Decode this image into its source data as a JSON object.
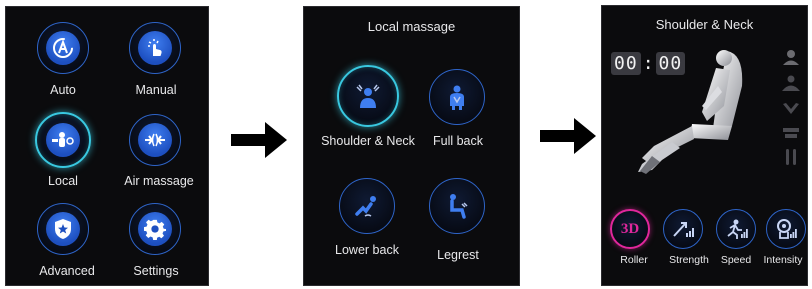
{
  "panel1": {
    "items": [
      {
        "label": "Auto",
        "icon": "auto-a-icon"
      },
      {
        "label": "Manual",
        "icon": "hand-touch-icon"
      },
      {
        "label": "Local",
        "icon": "local-massage-icon",
        "active": true
      },
      {
        "label": "Air massage",
        "icon": "air-arrows-icon"
      },
      {
        "label": "Advanced",
        "icon": "star-shield-icon"
      },
      {
        "label": "Settings",
        "icon": "gear-icon"
      }
    ]
  },
  "panel2": {
    "title": "Local massage",
    "items": [
      {
        "label": "Shoulder & Neck",
        "icon": "shoulder-neck-icon",
        "active": true
      },
      {
        "label": "Full back",
        "icon": "full-back-icon"
      },
      {
        "label": "Lower back",
        "icon": "lower-back-icon"
      },
      {
        "label": "Legrest",
        "icon": "legrest-icon"
      }
    ]
  },
  "panel3": {
    "title": "Shoulder & Neck",
    "timer": {
      "minutes": "00",
      "seconds": "00",
      "separator": ":"
    },
    "side_icons": [
      "neck-zone-icon",
      "shoulder-zone-icon",
      "back-zone-icon",
      "seat-zone-icon",
      "leg-zone-icon"
    ],
    "functions": [
      {
        "label": "Roller",
        "icon_text": "3D",
        "active": true
      },
      {
        "label": "Strength",
        "icon": "strength-level-icon"
      },
      {
        "label": "Speed",
        "icon": "speed-level-icon"
      },
      {
        "label": "Intensity",
        "icon": "intensity-level-icon"
      }
    ]
  },
  "colors": {
    "background": "#0b0b0d",
    "ring": "#2e64c8",
    "active_ring": "#39c8e0",
    "roller_ring": "#e0279c",
    "icon_fill": "#3f7ef0"
  }
}
